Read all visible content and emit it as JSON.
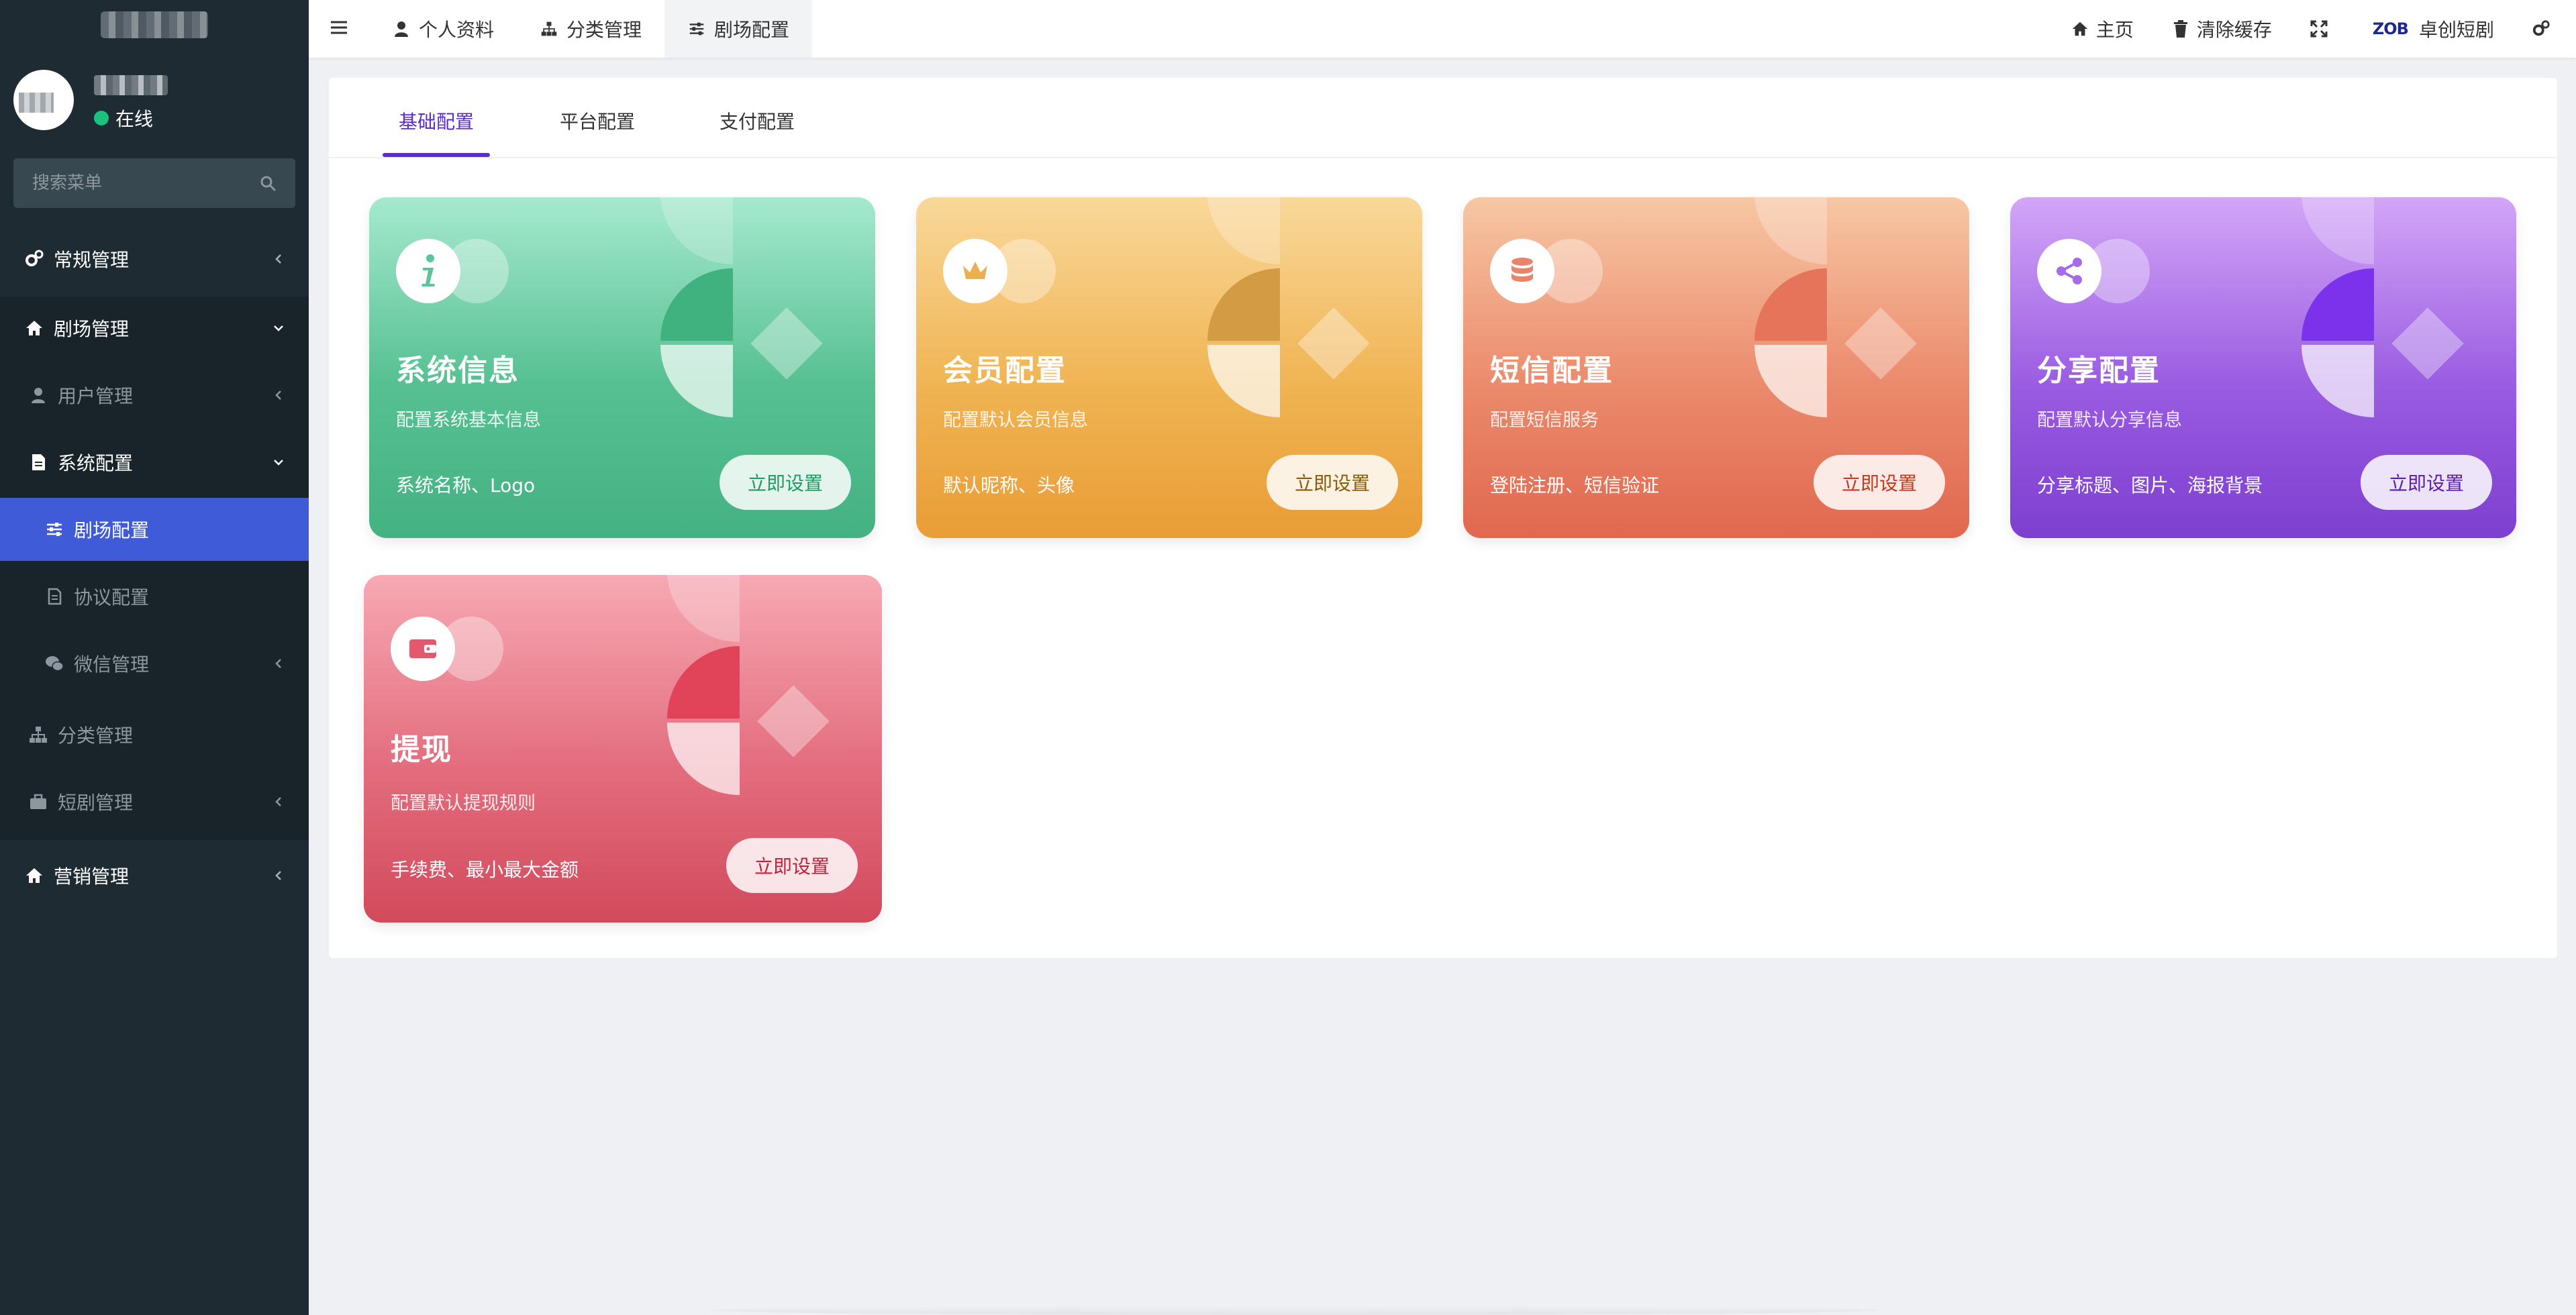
{
  "sidebar": {
    "user": {
      "status": "在线"
    },
    "search": {
      "placeholder": "搜索菜单"
    },
    "menu": [
      {
        "label": "常规管理",
        "icon": "cogs-icon",
        "level": 1
      },
      {
        "label": "剧场管理",
        "icon": "home-icon",
        "level": 1,
        "expanded": true
      },
      {
        "label": "用户管理",
        "icon": "user-icon",
        "level": 2
      },
      {
        "label": "系统配置",
        "icon": "file-icon",
        "level": 2,
        "expanded": true
      },
      {
        "label": "剧场配置",
        "icon": "sliders-icon",
        "level": 3,
        "active": true
      },
      {
        "label": "协议配置",
        "icon": "file-contract-icon",
        "level": 3
      },
      {
        "label": "微信管理",
        "icon": "wechat-icon",
        "level": 3
      },
      {
        "label": "分类管理",
        "icon": "sitemap-icon",
        "level": 2
      },
      {
        "label": "短剧管理",
        "icon": "briefcase-icon",
        "level": 2
      },
      {
        "label": "营销管理",
        "icon": "home-icon",
        "level": 1
      }
    ]
  },
  "topbar": {
    "tabs": [
      {
        "label": "个人资料",
        "icon": "user-icon"
      },
      {
        "label": "分类管理",
        "icon": "sitemap-icon"
      },
      {
        "label": "剧场配置",
        "icon": "sliders-icon",
        "current": true
      }
    ],
    "right": {
      "home": "主页",
      "clear_cache": "清除缓存",
      "site_name": "卓创短剧",
      "logo_text": "ZOB"
    }
  },
  "content": {
    "tabs": [
      "基础配置",
      "平台配置",
      "支付配置"
    ],
    "active_tab": "基础配置",
    "cards": [
      {
        "title": "系统信息",
        "desc": "配置系统基本信息",
        "features": "系统名称、Logo",
        "button": "立即设置",
        "icon": "info-icon",
        "color": "#4fbb8c"
      },
      {
        "title": "会员配置",
        "desc": "配置默认会员信息",
        "features": "默认昵称、头像",
        "button": "立即设置",
        "icon": "crown-icon",
        "color": "#ecaa45"
      },
      {
        "title": "短信配置",
        "desc": "配置短信服务",
        "features": "登陆注册、短信验证",
        "button": "立即设置",
        "icon": "database-icon",
        "color": "#e6795d"
      },
      {
        "title": "分享配置",
        "desc": "配置默认分享信息",
        "features": "分享标题、图片、海报背景",
        "button": "立即设置",
        "icon": "share-icon",
        "color": "#8a4cd8"
      },
      {
        "title": "提现",
        "desc": "配置默认提现规则",
        "features": "手续费、最小最大金额",
        "button": "立即设置",
        "icon": "wallet-icon",
        "color": "#dc5b6d"
      }
    ]
  }
}
